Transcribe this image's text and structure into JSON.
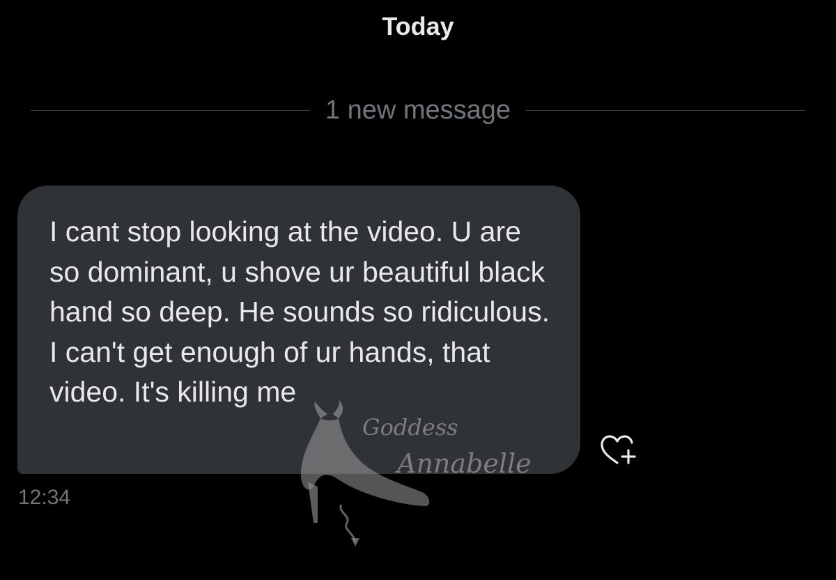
{
  "conversation": {
    "date_header": "Today",
    "new_message_divider": "1 new message"
  },
  "message": {
    "text": "I cant stop looking at the video. U are so dominant, u shove ur beautiful black hand so deep. He sounds so ridiculous. I can't get enough of ur hands, that video. It's killing me",
    "timestamp": "12:34",
    "react_icon": "heart-plus-icon"
  },
  "watermark": {
    "line1": "Goddess",
    "line2": "Annabelle",
    "icon": "devil-high-heel-logo"
  },
  "colors": {
    "background": "#000000",
    "bubble": "#2f3336",
    "primary_text": "#e7e9ea",
    "secondary_text": "#71767b"
  }
}
